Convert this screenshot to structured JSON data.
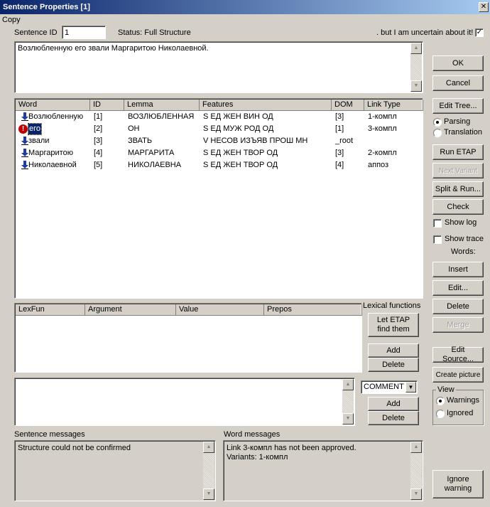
{
  "window": {
    "title": "Sentence Properties [1]"
  },
  "menu": {
    "copy": "Copy"
  },
  "sentence": {
    "id_label": "Sentence ID",
    "id_value": "1",
    "status": "Status: Full Structure",
    "uncertain_label": ". but I am uncertain about it!",
    "uncertain_checked": "✓",
    "text": "Возлюбленную его звали Маргаритою Николаевной."
  },
  "words_table": {
    "headers": [
      "Word",
      "ID",
      "Lemma",
      "Features",
      "DOM",
      "Link Type"
    ],
    "rows": [
      {
        "word": "Возлюбленную",
        "id": "[1]",
        "lemma": "ВОЗЛЮБЛЕННАЯ",
        "features": "S ЕД ЖЕН ВИН ОД",
        "dom": "[3]",
        "link": "1-компл",
        "icon": "arrow-down-icon"
      },
      {
        "word": "его",
        "id": "[2]",
        "lemma": "ОН",
        "features": "S ЕД МУЖ РОД ОД",
        "dom": "[1]",
        "link": "3-компл",
        "icon": "warning-icon"
      },
      {
        "word": "звали",
        "id": "[3]",
        "lemma": "ЗВАТЬ",
        "features": "V НЕСОВ ИЗЪЯВ ПРОШ МН",
        "dom": "_root",
        "link": "",
        "icon": "arrow-down-icon"
      },
      {
        "word": "Маргаритою",
        "id": "[4]",
        "lemma": "МАРГАРИТА",
        "features": "S ЕД ЖЕН ТВОР ОД",
        "dom": "[3]",
        "link": "2-компл",
        "icon": "arrow-down-icon"
      },
      {
        "word": "Николаевной",
        "id": "[5]",
        "lemma": "НИКОЛАЕВНА",
        "features": "S ЕД ЖЕН ТВОР ОД",
        "dom": "[4]",
        "link": "аппоз",
        "icon": "arrow-down-icon"
      }
    ]
  },
  "lexfun_table": {
    "headers": [
      "LexFun",
      "Argument",
      "Value",
      "Prepos"
    ],
    "section_label": "Lexical functions",
    "let_etap": "Let ETAP find them",
    "add": "Add",
    "delete": "Delete"
  },
  "comment": {
    "select_value": "COMMENT",
    "add": "Add",
    "delete": "Delete"
  },
  "messages": {
    "sentence_label": "Sentence messages",
    "sentence_text": "Structure could not be confirmed",
    "word_label": "Word messages",
    "word_text": "Link 3-компл has not been approved.\nVariants: 1-компл"
  },
  "right_panel": {
    "ok": "OK",
    "cancel": "Cancel",
    "edit_tree": "Edit Tree...",
    "parsing": "Parsing",
    "translation": "Translation",
    "run_etap": "Run ETAP",
    "next_variant": "Next Variant",
    "split_run": "Split & Run...",
    "check": "Check",
    "show_log": "Show log",
    "show_trace": "Show trace",
    "words_label": "Words:",
    "insert": "Insert",
    "edit": "Edit...",
    "delete": "Delete",
    "merge": "Merge",
    "edit_source": "Edit Source...",
    "create_picture": "Create picture",
    "view_label": "View",
    "warnings": "Warnings",
    "ignored": "Ignored",
    "ignore_warning": "Ignore warning"
  }
}
